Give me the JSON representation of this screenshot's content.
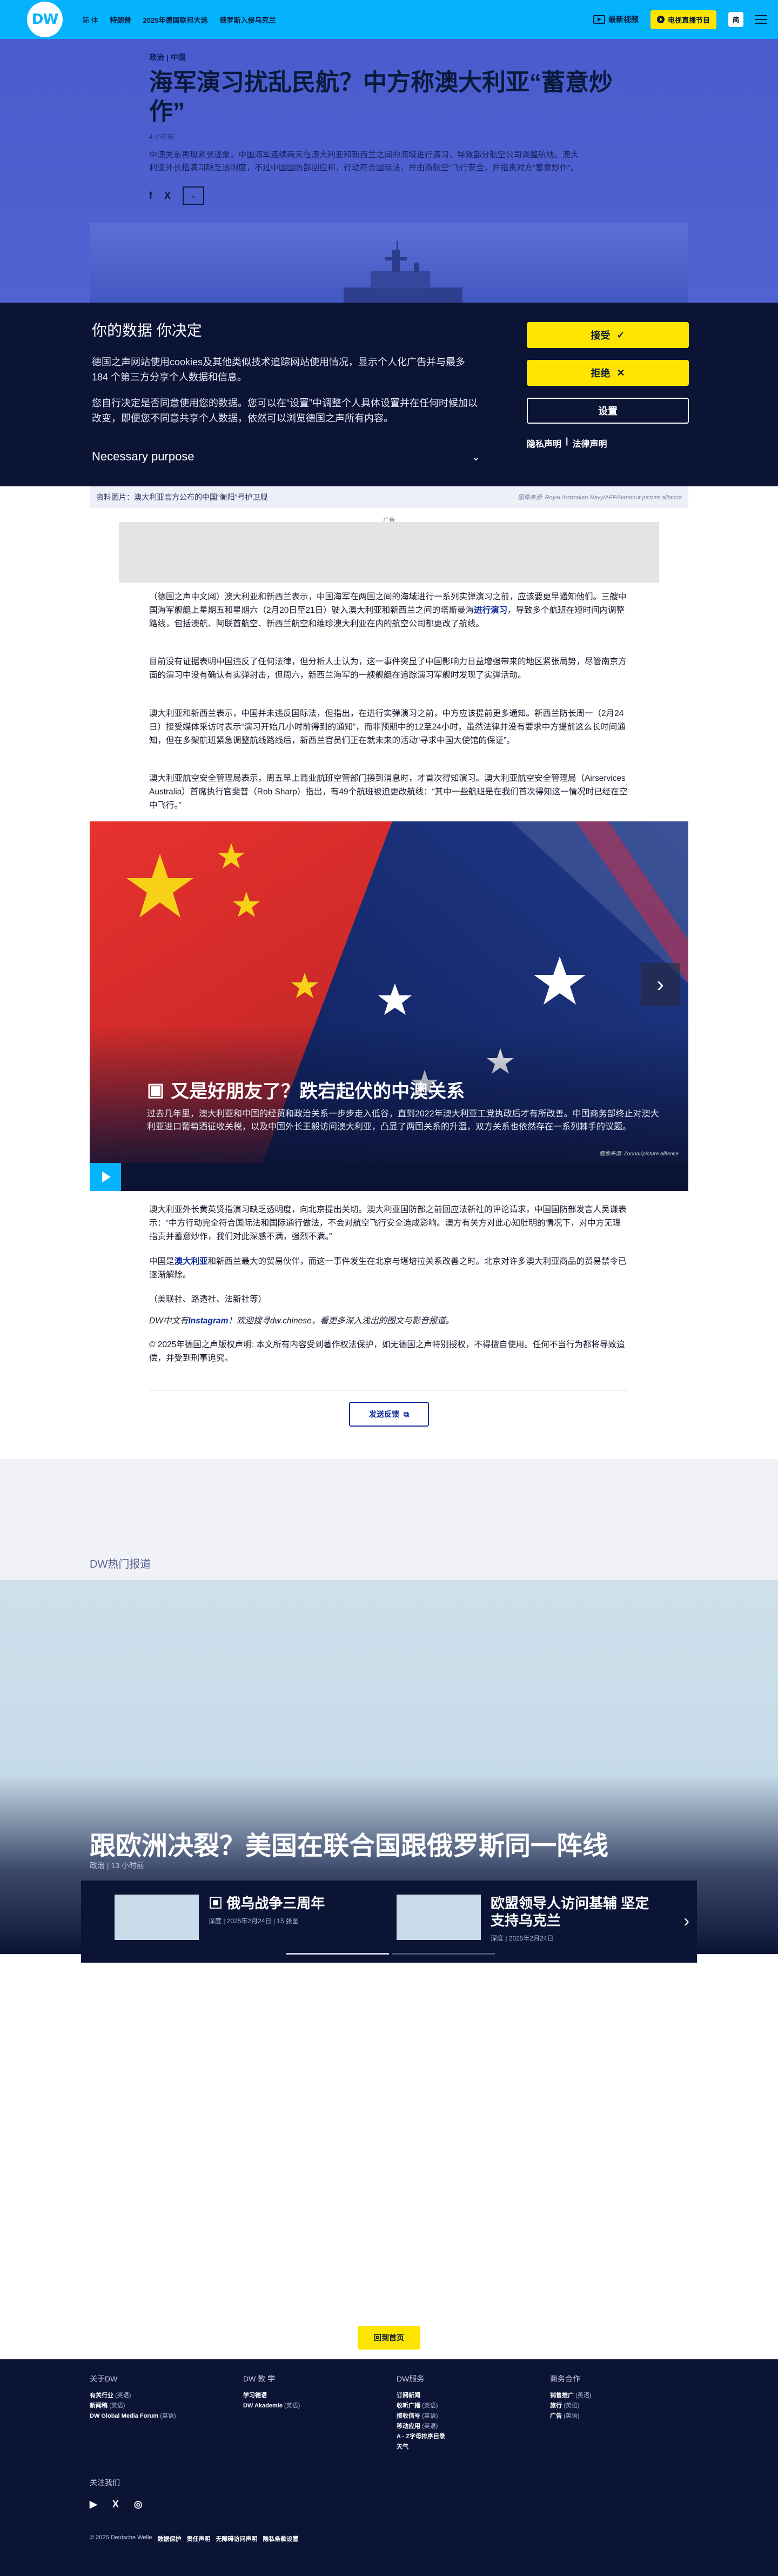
{
  "header": {
    "logo": "DW",
    "nav": [
      "简 体",
      "特朗普",
      "2025年德国联邦大选",
      "俄罗斯入侵乌克兰"
    ],
    "latest_video": "最新视频",
    "live": "电视直播节目",
    "lang": "简"
  },
  "article": {
    "kicker": "政治 | 中国",
    "title": "海军演习扰乱民航？中方称澳大利亚“蓄意炒作”",
    "meta": "4 小时前",
    "lead": "中澳关系再现紧张迹象。中国海军连续两天在澳大利亚和新西兰之间的海域进行演习，导致部分航空公司调整航线。澳大利亚外长指演习缺乏透明度，不过中国国防部回应称，行动符合国际法，并由斯航空“飞行安全，并指责对方“蓄意炒作”。",
    "share": [
      "f",
      "X"
    ],
    "caption": "资料图片：澳大利亚官方公布的中国“衡阳”号护卫舰",
    "caption_credit": "图像来源: Royal Australian Navy/AFP/Handout picture alliance",
    "ad_label": "广告",
    "paragraphs": [
      {
        "pre": "（德国之声中文网）澳大利亚和新西兰表示，中国海军在两国之间的海域进行一系列实弹演习之前，应该要更早通知他们。三艘中国海军舰艇上星期五和星期六（2月20日至21日）驶入澳大利亚和新西兰之间的塔斯曼海",
        "link": "进行演习",
        "post": "，导致多个航班在短时间内调整路线，包括澳航、阿联酋航空、新西兰航空和维珍澳大利亚在内的航空公司都更改了航线。"
      },
      {
        "pre": "目前没有证据表明中国违反了任何法律，但分析人士认为，这一事件突显了中国影响力日益增强带来的地区紧张局势，尽管南京方面的演习中没有确认有实弹射击，但周六，新西兰海军的一艘舰艇在追踪演习军舰时发现了实弹活动。",
        "link": "",
        "post": ""
      },
      {
        "pre": "澳大利亚和新西兰表示，中国并未违反国际法，但指出，在进行实弹演习之前，中方应该提前更多通知。新西兰防长周一（2月24日）接受媒体采访时表示“演习开始几小时前得到的通知”，而非预期中的12至24小时，虽然法律并没有要求中方提前这么长时间通知，但在多架航班紧急调整航线路线后，新西兰官员们正在就未来的活动“寻求中国大使馆的保证”。",
        "link": "",
        "post": ""
      },
      {
        "pre": "澳大利亚航空安全管理局表示，周五早上商业航班空管部门接到消息时，才首次得知演习。澳大利亚航空安全管理局（Airservices Australia）首席执行官斐普（Rob Sharp）指出，有49个航班被迫更改航线：“其中一些航班是在我们首次得知这一情况时已经在空中飞行。”",
        "link": "",
        "post": ""
      }
    ],
    "gallery": {
      "title": "又是好朋友了？跌宕起伏的中澳关系",
      "desc": "过去几年里，澳大利亚和中国的经贸和政治关系一步步走入低谷，直到2022年澳大利亚工党执政后才有所改善。中国商务部终止对澳大利亚进口葡萄酒征收关税，以及中国外长王毅访问澳大利亚，凸显了两国关系的升温，双方关系也依然存在一系列棘手的议题。",
      "credit": "图像来源: Zoonar/picture alliance"
    },
    "paragraphs2": [
      {
        "pre": "澳大利亚外长黄英贤指演习缺乏透明度，向北京提出关切。澳大利亚国防部之前回应法新社的评论请求，中国国防部发言人吴谦表示：“中方行动完全符合国际法和国际通行做法，不会对航空飞行安全造成影响。澳方有关方对此心知肚明的情况下，对中方无理指责并蓄意炒作，我们对此深感不满，强烈不满。”",
        "link": "",
        "post": ""
      },
      {
        "pre": "中国是",
        "link": "澳大利亚",
        "post": "和新西兰最大的贸易伙伴，而这一事件发生在北京与堪培拉关系改善之时。北京对许多澳大利亚商品的贸易禁令已逐渐解除。"
      },
      {
        "pre": "（美联社、路透社、法新社等）",
        "link": "",
        "post": ""
      }
    ],
    "instagram_line": {
      "pre": "DW中文有",
      "link": "Instagram",
      "post": "！欢迎搜寻dw.chinese，看更多深入浅出的图文与影音报道。"
    },
    "copyright": "© 2025年德国之声版权声明: 本文所有内容受到著作权法保护，如无德国之声特别授权，不得擅自使用。任何不当行为都将导致追偿，并受到刑事追究。",
    "feedback": "发送反馈"
  },
  "cookie": {
    "title": "你的数据 你决定",
    "p1": "德国之声网站使用cookies及其他类似技术追踪网站使用情况，显示个人化广告并与最多184 个第三方分享个人数据和信息。",
    "p2": "您自行决定是否同意使用您的数据。您可以在“设置”中调整个人具体设置并在任何时候加以改变，即便您不同意共享个人数据，依然可以浏览德国之声所有内容。",
    "purpose": "Necessary purpose",
    "accept": "接受",
    "reject": "拒绝",
    "settings": "设置",
    "privacy": "隐私声明",
    "legal": "法律声明"
  },
  "featured": {
    "section": "DW热门报道",
    "title": "跟欧洲决裂？美国在联合国跟俄罗斯同一阵线",
    "meta": "政治 | 13 小时前",
    "cards": [
      {
        "title": "俄乌战争三周年",
        "meta": "深度 | 2025年2月24日 | 15 张图"
      },
      {
        "title": "欧盟领导人访问基辅 坚定支持乌克兰",
        "meta": "深度 | 2025年2月24日"
      }
    ]
  },
  "footer": {
    "top_button": "回到首页",
    "cols": [
      {
        "title": "关于DW",
        "items": [
          {
            "a": "有关行业",
            "b": "(英语)"
          },
          {
            "a": "新闻稿",
            "b": "(英语)"
          },
          {
            "a": "DW Global Media Forum",
            "b": "(英语)"
          }
        ]
      },
      {
        "title": "DW 教 学",
        "items": [
          {
            "a": "学习德语",
            "b": ""
          },
          {
            "a": "DW Akademie",
            "b": "(英语)"
          }
        ]
      },
      {
        "title": "DW服务",
        "items": [
          {
            "a": "订阅新闻",
            "b": ""
          },
          {
            "a": "收听广播",
            "b": "(英语)"
          },
          {
            "a": "接收信号",
            "b": "(英语)"
          },
          {
            "a": "移动应用",
            "b": "(英语)"
          },
          {
            "a": "A - Z字母排序目录",
            "b": ""
          },
          {
            "a": "天气",
            "b": ""
          }
        ]
      },
      {
        "title": "商务合作",
        "items": [
          {
            "a": "销售推广",
            "b": "(英语)"
          },
          {
            "a": "旅行",
            "b": "(英语)"
          },
          {
            "a": "广告",
            "b": "(英语)"
          }
        ]
      }
    ],
    "follow": "关注我们",
    "social": [
      "▶",
      "X",
      "◎"
    ],
    "legal": [
      "© 2025 Deutsche Welle",
      "数据保护",
      "责任声明",
      "无障碍访问声明",
      "隐私条款设置"
    ]
  }
}
